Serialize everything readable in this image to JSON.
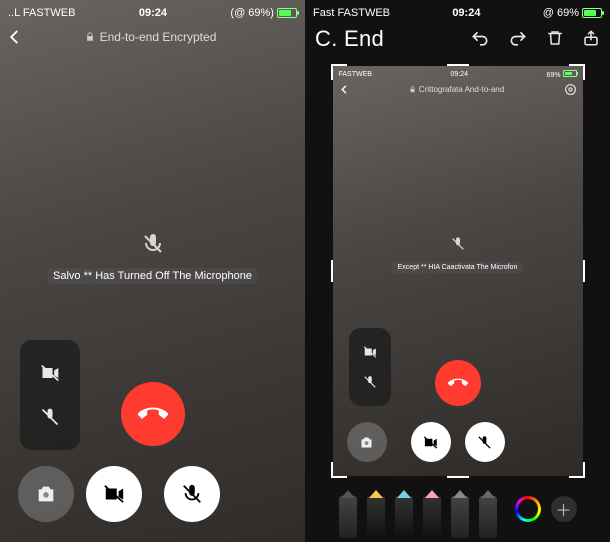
{
  "left": {
    "status": {
      "carrier": "..L FASTWEB",
      "wifi": "􀙇",
      "time": "09:24",
      "battery_text": "(@ 69%)"
    },
    "header": {
      "encrypted_label": "End-to-end Encrypted"
    },
    "toast": {
      "text": "Salvo ** Has Turned Off The Microphone"
    },
    "controls": {
      "camera_off_icon": "camera-off",
      "mic_off_icon": "mic-off",
      "capture_icon": "camera",
      "hangup_icon": "hang-up",
      "video_toggle_icon": "video-off",
      "mic_toggle_icon": "mic-off"
    }
  },
  "right": {
    "status": {
      "carrier": "Fast FASTWEB",
      "time": "09:24",
      "battery_text": "@ 69%"
    },
    "editor": {
      "title": "C. End",
      "undo": "undo",
      "redo": "redo",
      "delete": "trash",
      "share": "share"
    },
    "inner": {
      "status": {
        "carrier": "FASTWEB",
        "time": "09:24",
        "battery_text": "69%"
      },
      "header": {
        "encrypted_label": "Crittografata And-to-and"
      },
      "toast": {
        "text": "Except ** HIA Caactivata The Microfon"
      }
    },
    "tools": {
      "pen": "pen",
      "marker": "marker",
      "highlighter": "highlighter",
      "eraser": "eraser",
      "lasso": "lasso",
      "ruler": "ruler",
      "color": "color-picker",
      "add": "add-tool"
    }
  }
}
